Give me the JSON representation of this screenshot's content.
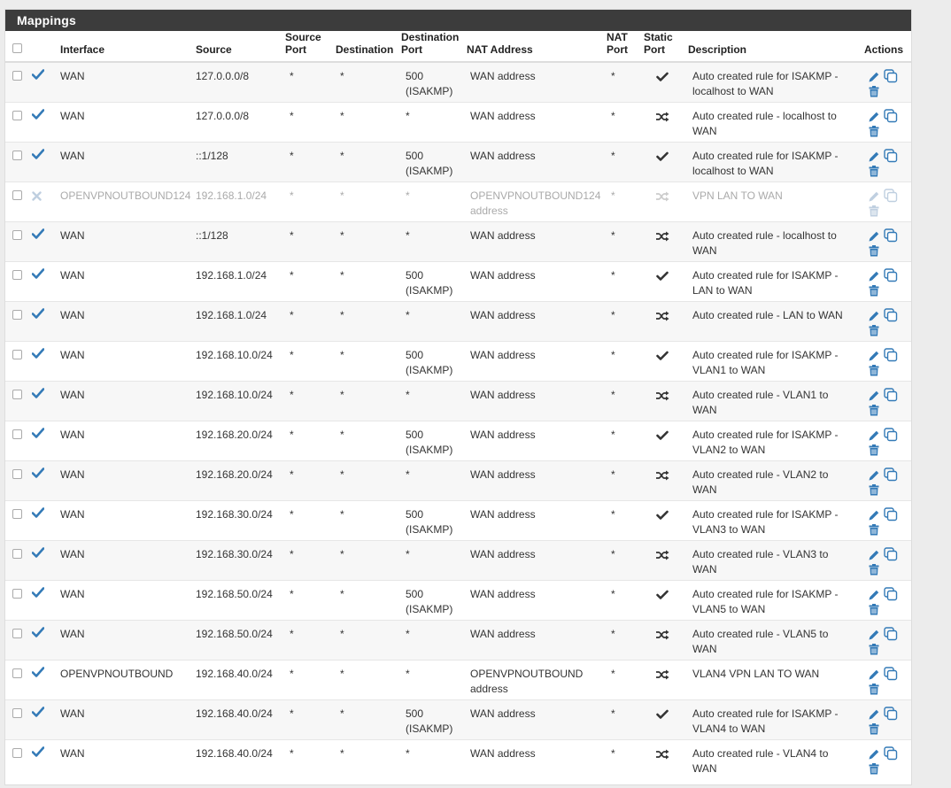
{
  "panel": {
    "title": "Mappings"
  },
  "columns": {
    "interface": "Interface",
    "source": "Source",
    "source_port": "Source Port",
    "destination": "Destination",
    "destination_port": "Destination Port",
    "nat_address": "NAT Address",
    "nat_port": "NAT Port",
    "static_port": "Static Port",
    "description": "Description",
    "actions": "Actions"
  },
  "rows": [
    {
      "enabled": true,
      "interface": "WAN",
      "source": "127.0.0.0/8",
      "source_port": "*",
      "destination": "*",
      "dest_port": "500 (ISAKMP)",
      "nat_address": "WAN address",
      "nat_port": "*",
      "static": "check",
      "description": "Auto created rule for ISAKMP - localhost to WAN"
    },
    {
      "enabled": true,
      "interface": "WAN",
      "source": "127.0.0.0/8",
      "source_port": "*",
      "destination": "*",
      "dest_port": "*",
      "nat_address": "WAN address",
      "nat_port": "*",
      "static": "random",
      "description": "Auto created rule - localhost to WAN"
    },
    {
      "enabled": true,
      "interface": "WAN",
      "source": "::1/128",
      "source_port": "*",
      "destination": "*",
      "dest_port": "500 (ISAKMP)",
      "nat_address": "WAN address",
      "nat_port": "*",
      "static": "check",
      "description": "Auto created rule for ISAKMP - localhost to WAN"
    },
    {
      "enabled": false,
      "interface": "OPENVPNOUTBOUND124",
      "source": "192.168.1.0/24",
      "source_port": "*",
      "destination": "*",
      "dest_port": "*",
      "nat_address": "OPENVPNOUTBOUND124 address",
      "nat_port": "*",
      "static": "random",
      "description": "VPN LAN TO WAN"
    },
    {
      "enabled": true,
      "interface": "WAN",
      "source": "::1/128",
      "source_port": "*",
      "destination": "*",
      "dest_port": "*",
      "nat_address": "WAN address",
      "nat_port": "*",
      "static": "random",
      "description": "Auto created rule - localhost to WAN"
    },
    {
      "enabled": true,
      "interface": "WAN",
      "source": "192.168.1.0/24",
      "source_port": "*",
      "destination": "*",
      "dest_port": "500 (ISAKMP)",
      "nat_address": "WAN address",
      "nat_port": "*",
      "static": "check",
      "description": "Auto created rule for ISAKMP - LAN to WAN"
    },
    {
      "enabled": true,
      "interface": "WAN",
      "source": "192.168.1.0/24",
      "source_port": "*",
      "destination": "*",
      "dest_port": "*",
      "nat_address": "WAN address",
      "nat_port": "*",
      "static": "random",
      "description": "Auto created rule - LAN to WAN"
    },
    {
      "enabled": true,
      "interface": "WAN",
      "source": "192.168.10.0/24",
      "source_port": "*",
      "destination": "*",
      "dest_port": "500 (ISAKMP)",
      "nat_address": "WAN address",
      "nat_port": "*",
      "static": "check",
      "description": "Auto created rule for ISAKMP - VLAN1 to WAN"
    },
    {
      "enabled": true,
      "interface": "WAN",
      "source": "192.168.10.0/24",
      "source_port": "*",
      "destination": "*",
      "dest_port": "*",
      "nat_address": "WAN address",
      "nat_port": "*",
      "static": "random",
      "description": "Auto created rule - VLAN1 to WAN"
    },
    {
      "enabled": true,
      "interface": "WAN",
      "source": "192.168.20.0/24",
      "source_port": "*",
      "destination": "*",
      "dest_port": "500 (ISAKMP)",
      "nat_address": "WAN address",
      "nat_port": "*",
      "static": "check",
      "description": "Auto created rule for ISAKMP - VLAN2 to WAN"
    },
    {
      "enabled": true,
      "interface": "WAN",
      "source": "192.168.20.0/24",
      "source_port": "*",
      "destination": "*",
      "dest_port": "*",
      "nat_address": "WAN address",
      "nat_port": "*",
      "static": "random",
      "description": "Auto created rule - VLAN2 to WAN"
    },
    {
      "enabled": true,
      "interface": "WAN",
      "source": "192.168.30.0/24",
      "source_port": "*",
      "destination": "*",
      "dest_port": "500 (ISAKMP)",
      "nat_address": "WAN address",
      "nat_port": "*",
      "static": "check",
      "description": "Auto created rule for ISAKMP - VLAN3 to WAN"
    },
    {
      "enabled": true,
      "interface": "WAN",
      "source": "192.168.30.0/24",
      "source_port": "*",
      "destination": "*",
      "dest_port": "*",
      "nat_address": "WAN address",
      "nat_port": "*",
      "static": "random",
      "description": "Auto created rule - VLAN3 to WAN"
    },
    {
      "enabled": true,
      "interface": "WAN",
      "source": "192.168.50.0/24",
      "source_port": "*",
      "destination": "*",
      "dest_port": "500 (ISAKMP)",
      "nat_address": "WAN address",
      "nat_port": "*",
      "static": "check",
      "description": "Auto created rule for ISAKMP - VLAN5 to WAN"
    },
    {
      "enabled": true,
      "interface": "WAN",
      "source": "192.168.50.0/24",
      "source_port": "*",
      "destination": "*",
      "dest_port": "*",
      "nat_address": "WAN address",
      "nat_port": "*",
      "static": "random",
      "description": "Auto created rule - VLAN5 to WAN"
    },
    {
      "enabled": true,
      "interface": "OPENVPNOUTBOUND",
      "source": "192.168.40.0/24",
      "source_port": "*",
      "destination": "*",
      "dest_port": "*",
      "nat_address": "OPENVPNOUTBOUND address",
      "nat_port": "*",
      "static": "random",
      "description": "VLAN4 VPN LAN TO WAN"
    },
    {
      "enabled": true,
      "interface": "WAN",
      "source": "192.168.40.0/24",
      "source_port": "*",
      "destination": "*",
      "dest_port": "500 (ISAKMP)",
      "nat_address": "WAN address",
      "nat_port": "*",
      "static": "check",
      "description": "Auto created rule for ISAKMP - VLAN4 to WAN"
    },
    {
      "enabled": true,
      "interface": "WAN",
      "source": "192.168.40.0/24",
      "source_port": "*",
      "destination": "*",
      "dest_port": "*",
      "nat_address": "WAN address",
      "nat_port": "*",
      "static": "random",
      "description": "Auto created rule - VLAN4 to WAN"
    }
  ],
  "colors": {
    "heading_bg": "#3c3c3c",
    "enabled_icon": "#337ab7",
    "disabled_icon": "#bfcfe0",
    "action_icon": "#337ab7"
  },
  "icons": {
    "enabled": "check-icon",
    "disabled": "times-icon",
    "static_check": "check-icon",
    "static_random": "random-icon",
    "edit": "pencil-icon",
    "copy": "clone-icon",
    "delete": "trash-icon"
  }
}
